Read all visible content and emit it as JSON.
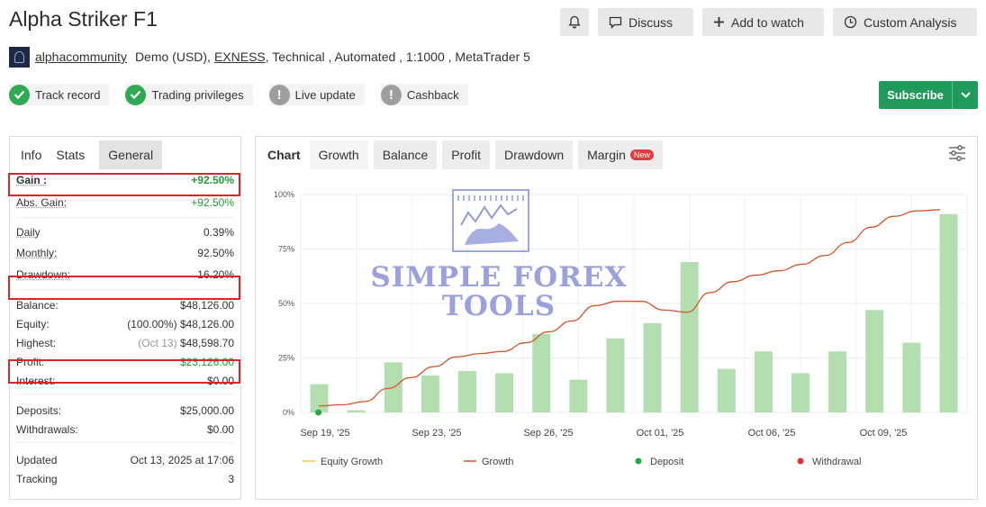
{
  "title": "Alpha Striker F1",
  "toolbar": {
    "discuss": "Discuss",
    "add_to_watch": "Add to watch",
    "custom_analysis": "Custom Analysis"
  },
  "account": {
    "owner": "alphacommunity",
    "type": "Demo (USD),",
    "broker": "EXNESS",
    "details": ", Technical , Automated , 1:1000 , MetaTrader 5"
  },
  "badges": [
    "Track record",
    "Trading privileges",
    "Live update",
    "Cashback"
  ],
  "subscribe_label": "Subscribe",
  "info_tabs": [
    "Info",
    "Stats",
    "General"
  ],
  "stats": {
    "gain": {
      "label": "Gain :",
      "value": "+92.50%"
    },
    "abs_gain": {
      "label": "Abs. Gain:",
      "value": "+92.50%"
    },
    "daily": {
      "label": "Daily",
      "value": "0.39%"
    },
    "monthly": {
      "label": "Monthly:",
      "value": "92.50%"
    },
    "drawdown": {
      "label": "Drawdown:",
      "value": "16.20%"
    },
    "balance": {
      "label": "Balance:",
      "value": "$48,126.00"
    },
    "equity": {
      "label": "Equity:",
      "pct": "(100.00%)",
      "value": "$48,126.00"
    },
    "highest": {
      "label": "Highest:",
      "date": "(Oct 13)",
      "value": "$48,598.70"
    },
    "profit": {
      "label": "Profit:",
      "value": "$23,126.00"
    },
    "interest": {
      "label": "Interest:",
      "value": "$0.00"
    },
    "deposits": {
      "label": "Deposits:",
      "value": "$25,000.00"
    },
    "withdrawals": {
      "label": "Withdrawals:",
      "value": "$0.00"
    },
    "updated": {
      "label": "Updated",
      "value": "Oct 13, 2025 at 17:06"
    },
    "tracking": {
      "label": "Tracking",
      "value": "3"
    }
  },
  "chart_tabs": [
    "Chart",
    "Growth",
    "Balance",
    "Profit",
    "Drawdown",
    "Margin"
  ],
  "new_badge": "New",
  "watermark": {
    "line1": "SIMPLE FOREX",
    "line2": "TOOLS"
  },
  "colors": {
    "bar": "#b3dfb0",
    "growth": "#d2552a",
    "equity": "#f5c542",
    "deposit": "#22aa44",
    "withdrawal": "#dd3333",
    "accent": "#1f9a5b"
  },
  "chart_data": {
    "type": "bar",
    "x_tick_labels": [
      "Sep 19, '25",
      "Sep 23, '25",
      "Sep 26, '25",
      "Oct 01, '25",
      "Oct 06, '25",
      "Oct 09, '25"
    ],
    "y_tick_labels": [
      "0%",
      "25%",
      "50%",
      "75%",
      "100%"
    ],
    "ylim": [
      0,
      100
    ],
    "bars": [
      13,
      1,
      23,
      17,
      19,
      18,
      36,
      15,
      34,
      41,
      69,
      20,
      28,
      18,
      28,
      47,
      32,
      91
    ],
    "growth_line": [
      3,
      3.5,
      5,
      11,
      16,
      21,
      25.5,
      27,
      28,
      32,
      37,
      42,
      49,
      51,
      51,
      47,
      46,
      55,
      60,
      63,
      65,
      68,
      72,
      78,
      85,
      90,
      92.5,
      93
    ],
    "legend": [
      "Equity Growth",
      "Growth",
      "Deposit",
      "Withdrawal"
    ],
    "deposit_marker_index": 0
  }
}
